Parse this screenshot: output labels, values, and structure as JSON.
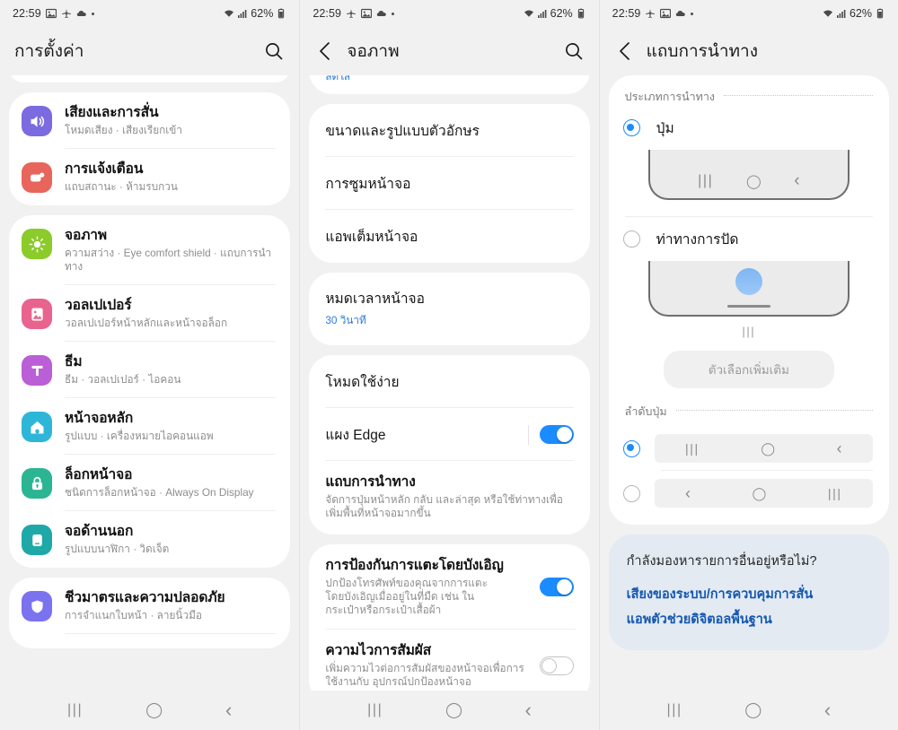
{
  "status_bar": {
    "time": "22:59",
    "battery": "62%",
    "icons": [
      "image-icon",
      "airplane-icon",
      "cloud-icon",
      "dot-icon",
      "wifi-icon",
      "signal-icon",
      "battery-icon"
    ]
  },
  "nav_bar": {
    "recents": "|||",
    "home": "◯",
    "back": "‹"
  },
  "screen1": {
    "title": "การตั้งค่า",
    "has_search": true,
    "groups": [
      {
        "partial": true,
        "items": []
      },
      {
        "partial": false,
        "items": [
          {
            "icon": "sound-icon",
            "color": "#7b6ae0",
            "title": "เสียงและการสั่น",
            "sub": "โหมดเสียง  ·  เสียงเรียกเข้า"
          },
          {
            "icon": "notification-icon",
            "color": "#e8655b",
            "title": "การแจ้งเตือน",
            "sub": "แถบสถานะ  ·  ห้ามรบกวน"
          }
        ]
      },
      {
        "partial": false,
        "items": [
          {
            "icon": "brightness-icon",
            "color": "#8bcb2a",
            "title": "จอภาพ",
            "sub": "ความสว่าง  ·  Eye comfort shield  ·  แถบการนำทาง"
          },
          {
            "icon": "wallpaper-icon",
            "color": "#e8638d",
            "title": "วอลเปเปอร์",
            "sub": "วอลเปเปอร์หน้าหลักและหน้าจอล็อก"
          },
          {
            "icon": "theme-icon",
            "color": "#bb5fd6",
            "title": "ธีม",
            "sub": "ธีม  ·  วอลเปเปอร์  ·  ไอคอน"
          },
          {
            "icon": "home-screen-icon",
            "color": "#2eb6d8",
            "title": "หน้าจอหลัก",
            "sub": "รูปแบบ  ·  เครื่องหมายไอคอนแอพ"
          },
          {
            "icon": "lock-screen-icon",
            "color": "#2bb592",
            "title": "ล็อกหน้าจอ",
            "sub": "ชนิดการล็อกหน้าจอ  ·  Always On Display"
          },
          {
            "icon": "cover-screen-icon",
            "color": "#1ea9a8",
            "title": "จอด้านนอก",
            "sub": "รูปแบบนาฬิกา  ·  วิดเจ็ต"
          }
        ]
      },
      {
        "partial": false,
        "items": [
          {
            "icon": "shield-icon",
            "color": "#7b72ef",
            "title": "ชีวมาตรและความปลอดภัย",
            "sub": "การจำแนกใบหน้า  ·  ลายนิ้วมือ"
          }
        ]
      }
    ]
  },
  "screen2": {
    "title": "จอภาพ",
    "has_search": true,
    "has_back": true,
    "partial_item": "สดใส",
    "group_a": [
      {
        "title": "ขนาดและรูปแบบตัวอักษร"
      },
      {
        "title": "การซูมหน้าจอ"
      },
      {
        "title": "แอพเต็มหน้าจอ"
      }
    ],
    "group_b": [
      {
        "title": "หมดเวลาหน้าจอ",
        "sub": "30 วินาที"
      }
    ],
    "group_c": [
      {
        "title": "โหมดใช้ง่าย",
        "type": "plain"
      },
      {
        "title": "แผง Edge",
        "type": "toggle",
        "toggle": "on"
      },
      {
        "title": "แถบการนำทาง",
        "sub": "จัดการปุ่มหน้าหลัก กลับ และล่าสุด หรือใช้ท่าทางเพื่อเพิ่มพื้นที่หน้าจอมากขึ้น",
        "type": "bold-sub"
      }
    ],
    "group_d": [
      {
        "title": "การป้องกันการแตะโดยบังเอิญ",
        "sub": "ปกป้องโทรศัพท์ของคุณจากการแตะโดยบังเอิญเมื่ออยู่ในที่มืด เช่น ในกระเป๋าหรือกระเป๋าเสื้อผ้า",
        "toggle": "on"
      },
      {
        "title": "ความไวการสัมผัส",
        "sub": "เพิ่มความไวต่อการสัมผัสของหน้าจอเพื่อการใช้งานกับ อุปกรณ์ปกป้องหน้าจอ",
        "toggle": "off"
      }
    ]
  },
  "screen3": {
    "title": "แถบการนำทาง",
    "has_search": false,
    "has_back": true,
    "section1_label": "ประเภทการนำทาง",
    "option_buttons": {
      "label": "ปุ่ม",
      "selected": true
    },
    "option_gestures": {
      "label": "ท่าทางการปัด",
      "selected": false
    },
    "more_options": "ตัวเลือกเพิ่มเติม",
    "section2_label": "ลำดับปุ่ม",
    "order_options": [
      {
        "glyphs": [
          "|||",
          "◯",
          "‹"
        ],
        "selected": true
      },
      {
        "glyphs": [
          "‹",
          "◯",
          "|||"
        ],
        "selected": false
      }
    ],
    "looking_for": {
      "question": "กำลังมองหารายการอื่นอยู่หรือไม่?",
      "links": [
        "เสียงของระบบ/การควบคุมการสั่น",
        "แอพตัวช่วยดิจิตอลพื้นฐาน"
      ]
    }
  },
  "colors": {
    "accent": "#1a8cff",
    "link": "#1558b0",
    "sublink": "#2b7de0",
    "card_bg": "#ffffff",
    "page_bg": "#f1f1f1",
    "looking_bg": "#e3eaf2"
  }
}
